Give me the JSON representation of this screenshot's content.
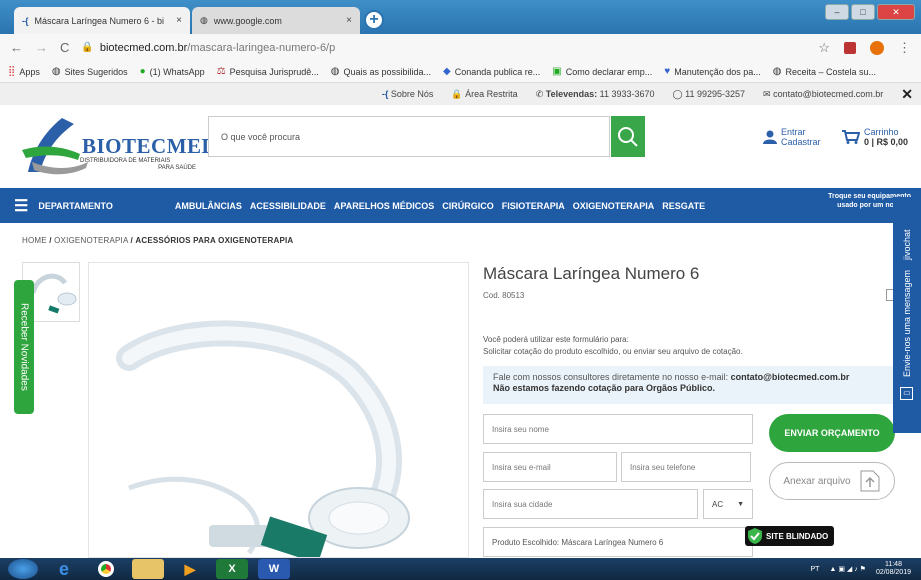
{
  "browser": {
    "tabs": [
      {
        "title": "Máscara Laríngea Numero 6 - bi",
        "close": "×"
      },
      {
        "title": "www.google.com",
        "close": "×"
      }
    ],
    "new_tab": "+",
    "url_domain": "biotecmed.com.br",
    "url_path": "/mascara-laringea-numero-6/p",
    "bookmarks": [
      {
        "icon": "apps-icon",
        "label": "Apps"
      },
      {
        "icon": "globe-icon",
        "label": "Sites Sugeridos"
      },
      {
        "icon": "whatsapp-icon",
        "label": "(1) WhatsApp"
      },
      {
        "icon": "jurisprudence-icon",
        "label": "Pesquisa Jurisprudê..."
      },
      {
        "icon": "globe-icon",
        "label": "Quais as possibilida..."
      },
      {
        "icon": "conanda-icon",
        "label": "Conanda publica re..."
      },
      {
        "icon": "money-icon",
        "label": "Como declarar emp..."
      },
      {
        "icon": "maintenance-icon",
        "label": "Manutenção dos pa..."
      },
      {
        "icon": "globe-icon",
        "label": "Receita – Costela su..."
      }
    ]
  },
  "infobar": {
    "about": "Sobre Nós",
    "restricted": "Área Restrita",
    "phone_label": "Televendas:",
    "phone": "11 3933-3670",
    "whatsapp": "11 99295-3257",
    "email": "contato@biotecmed.com.br"
  },
  "header": {
    "logo_name": "BIOTECMED",
    "logo_tagline_1": "DISTRIBUIDORA DE MATERIAIS",
    "logo_tagline_2": "PARA SAÚDE",
    "search_placeholder": "O que você procura",
    "account_login": "Entrar",
    "account_register": "Cadastrar",
    "cart_label": "Carrinho",
    "cart_value": "0 | R$ 0,00"
  },
  "nav": {
    "department": "DEPARTAMENTO",
    "items": [
      "AMBULÂNCIAS",
      "ACESSIBILIDADE",
      "APARELHOS MÉDICOS",
      "CIRÚRGICO",
      "FISIOTERAPIA",
      "OXIGENOTERAPIA",
      "RESGATE"
    ],
    "trade_1": "Troque seu equipamento",
    "trade_2": "usado por um novo"
  },
  "breadcrumb": {
    "home": "HOME",
    "category": "OXIGENOTERAPIA",
    "current": "ACESSÓRIOS PARA OXIGENOTERAPIA",
    "sep": "/"
  },
  "product": {
    "title": "Máscara Laríngea Numero 6",
    "code": "Cod. 80513",
    "info_1": "Você poderá utilizar este formulário para:",
    "info_2": "Solicitar cotação do produto escolhido, ou enviar seu arquivo de cotação.",
    "contact_text": "Fale com nossos consultores diretamente no nosso e-mail:",
    "contact_email": "contato@biotecmed.com.br",
    "contact_notice": "Não estamos fazendo cotação para Orgãos Público."
  },
  "form": {
    "name_placeholder": "Insira seu nome",
    "email_placeholder": "Insira seu e-mail",
    "phone_placeholder": "Insira seu telefone",
    "city_placeholder": "Insira sua cidade",
    "state_value": "AC",
    "product_field": "Produto Escolhido: Máscara Laríngea Numero 6",
    "send_button": "ENVIAR ORÇAMENTO",
    "attach_button": "Anexar arquivo"
  },
  "badges": {
    "site_blindado": "SITE BLINDADO"
  },
  "side_tabs": {
    "newsletter": "Receber Novidades",
    "jivochat": "jivochat",
    "chat_message": "Envie-nos uma mensagem"
  },
  "taskbar": {
    "language": "PT",
    "time": "11:48",
    "date": "02/08/2019"
  },
  "colors": {
    "brand_blue": "#1f5aa5",
    "brand_green": "#2fa53e",
    "search_green": "#3aa64a"
  }
}
